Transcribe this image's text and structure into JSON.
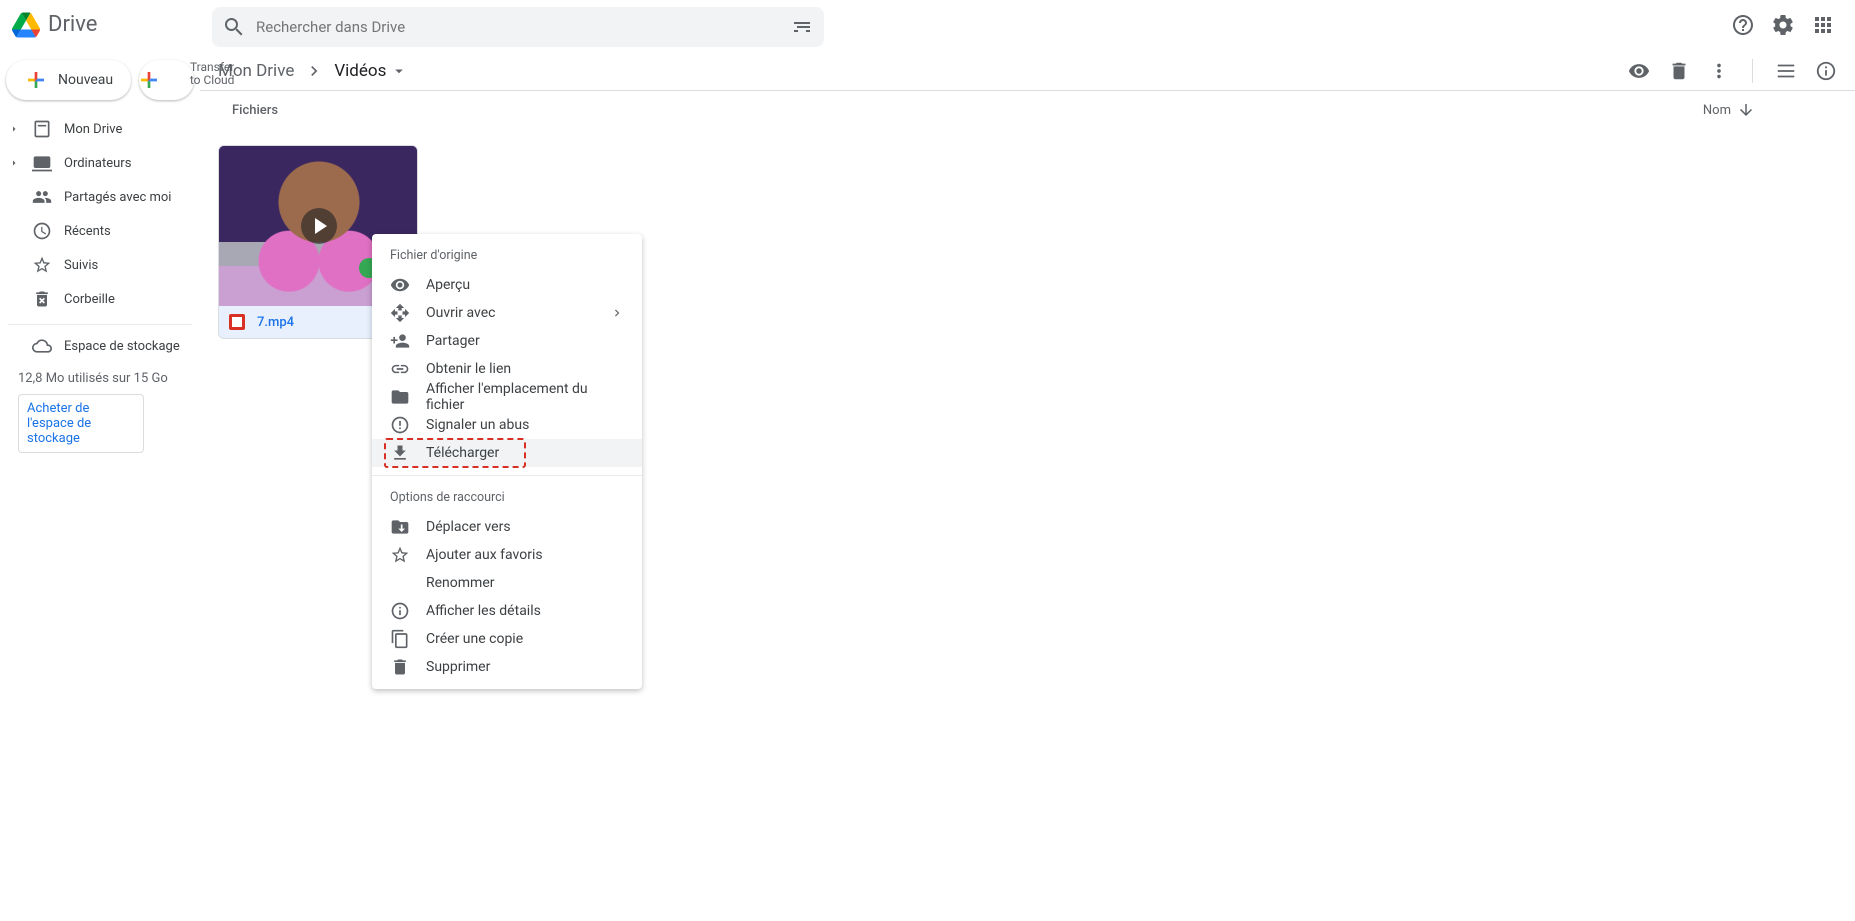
{
  "header": {
    "app_name": "Drive",
    "search_placeholder": "Rechercher dans Drive"
  },
  "sidebar": {
    "new_button_label": "Nouveau",
    "transfer_label": "Transfer to Cloud",
    "items": [
      {
        "label": "Mon Drive",
        "expandable": true
      },
      {
        "label": "Ordinateurs",
        "expandable": true
      },
      {
        "label": "Partagés avec moi",
        "expandable": false
      },
      {
        "label": "Récents",
        "expandable": false
      },
      {
        "label": "Suivis",
        "expandable": false
      },
      {
        "label": "Corbeille",
        "expandable": false
      }
    ],
    "storage_item": "Espace de stockage",
    "storage_usage": "12,8 Mo utilisés sur 15 Go",
    "buy_storage": "Acheter de l'espace de stockage"
  },
  "main": {
    "breadcrumbs": {
      "root": "Mon Drive",
      "current": "Vidéos"
    },
    "files_label": "Fichiers",
    "sort_label": "Nom",
    "file": {
      "name": "7.mp4"
    }
  },
  "context_menu": {
    "section1_label": "Fichier d'origine",
    "items1": [
      {
        "label": "Aperçu",
        "icon": "eye-icon"
      },
      {
        "label": "Ouvrir avec",
        "icon": "open-with-icon",
        "submenu": true
      },
      {
        "label": "Partager",
        "icon": "person-plus-icon"
      },
      {
        "label": "Obtenir le lien",
        "icon": "link-icon"
      },
      {
        "label": "Afficher l'emplacement du fichier",
        "icon": "folder-icon"
      },
      {
        "label": "Signaler un abus",
        "icon": "report-icon"
      },
      {
        "label": "Télécharger",
        "icon": "download-icon",
        "highlight": true
      }
    ],
    "section2_label": "Options de raccourci",
    "items2": [
      {
        "label": "Déplacer vers",
        "icon": "move-icon"
      },
      {
        "label": "Ajouter aux favoris",
        "icon": "star-icon"
      },
      {
        "label": "Renommer",
        "icon": "rename-icon"
      },
      {
        "label": "Afficher les détails",
        "icon": "info-icon"
      },
      {
        "label": "Créer une copie",
        "icon": "copy-icon"
      },
      {
        "label": "Supprimer",
        "icon": "trash-icon"
      }
    ]
  }
}
